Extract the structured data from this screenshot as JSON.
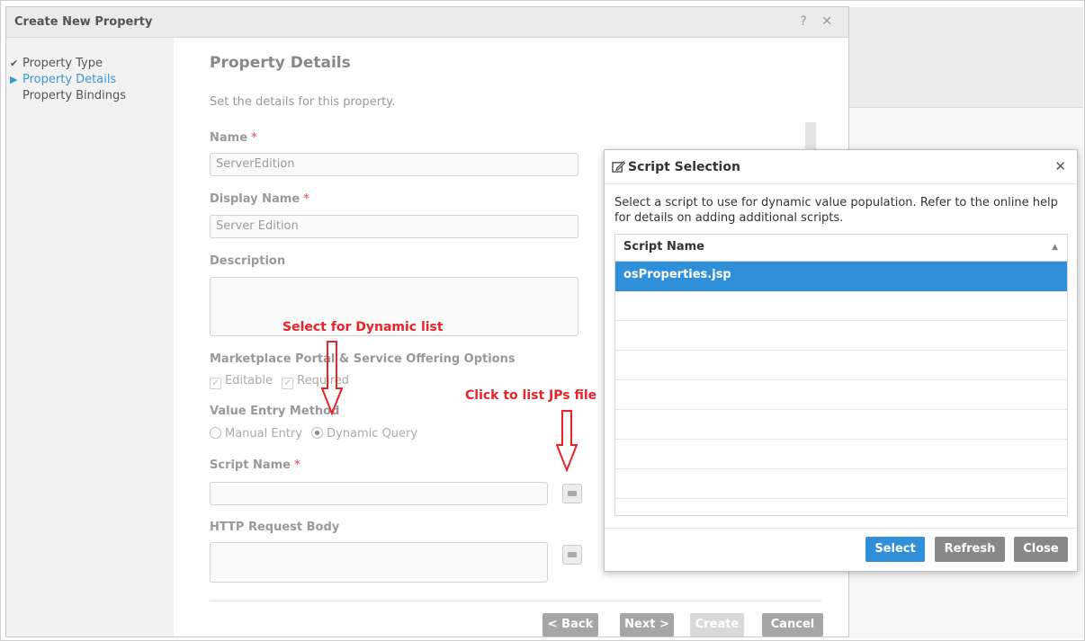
{
  "wizard": {
    "title": "Create New Property",
    "controls": "? ✕",
    "nav": [
      {
        "label": "Property Type",
        "marker": "✔"
      },
      {
        "label": "Property Details",
        "marker": "▶"
      },
      {
        "label": "Property Bindings",
        "marker": ""
      }
    ],
    "section_title": "Property Details",
    "intro": "Set the details for this property.",
    "fields": {
      "name_label": "Name",
      "name_value": "ServerEdition",
      "display_name_label": "Display Name",
      "display_name_value": "Server Edition",
      "description_label": "Description",
      "options_label": "Marketplace Portal & Service Offering Options",
      "editable_label": "Editable",
      "required_label": "Required",
      "value_entry_label": "Value Entry Method",
      "manual_entry_label": "Manual Entry",
      "dynamic_query_label": "Dynamic Query",
      "script_name_label": "Script Name",
      "http_body_label": "HTTP Request Body",
      "required_marker": "*"
    },
    "buttons": {
      "back": "< Back",
      "next": "Next >",
      "create": "Create",
      "cancel": "Cancel"
    }
  },
  "annotations": {
    "dynamic_list": "Select for Dynamic list",
    "jps_file": "Click to list JPs file"
  },
  "dialog": {
    "title": "Script Selection",
    "close_glyph": "✕",
    "description": "Select a script to use for dynamic value population. Refer to the online help for details on adding additional scripts.",
    "column_header": "Script Name",
    "rows": [
      "osProperties.jsp"
    ],
    "buttons": {
      "select": "Select",
      "refresh": "Refresh",
      "close": "Close"
    }
  },
  "colors": {
    "accent_blue": "#2f8fd8",
    "annotation_red": "#e8232a",
    "button_gray": "#888888"
  }
}
